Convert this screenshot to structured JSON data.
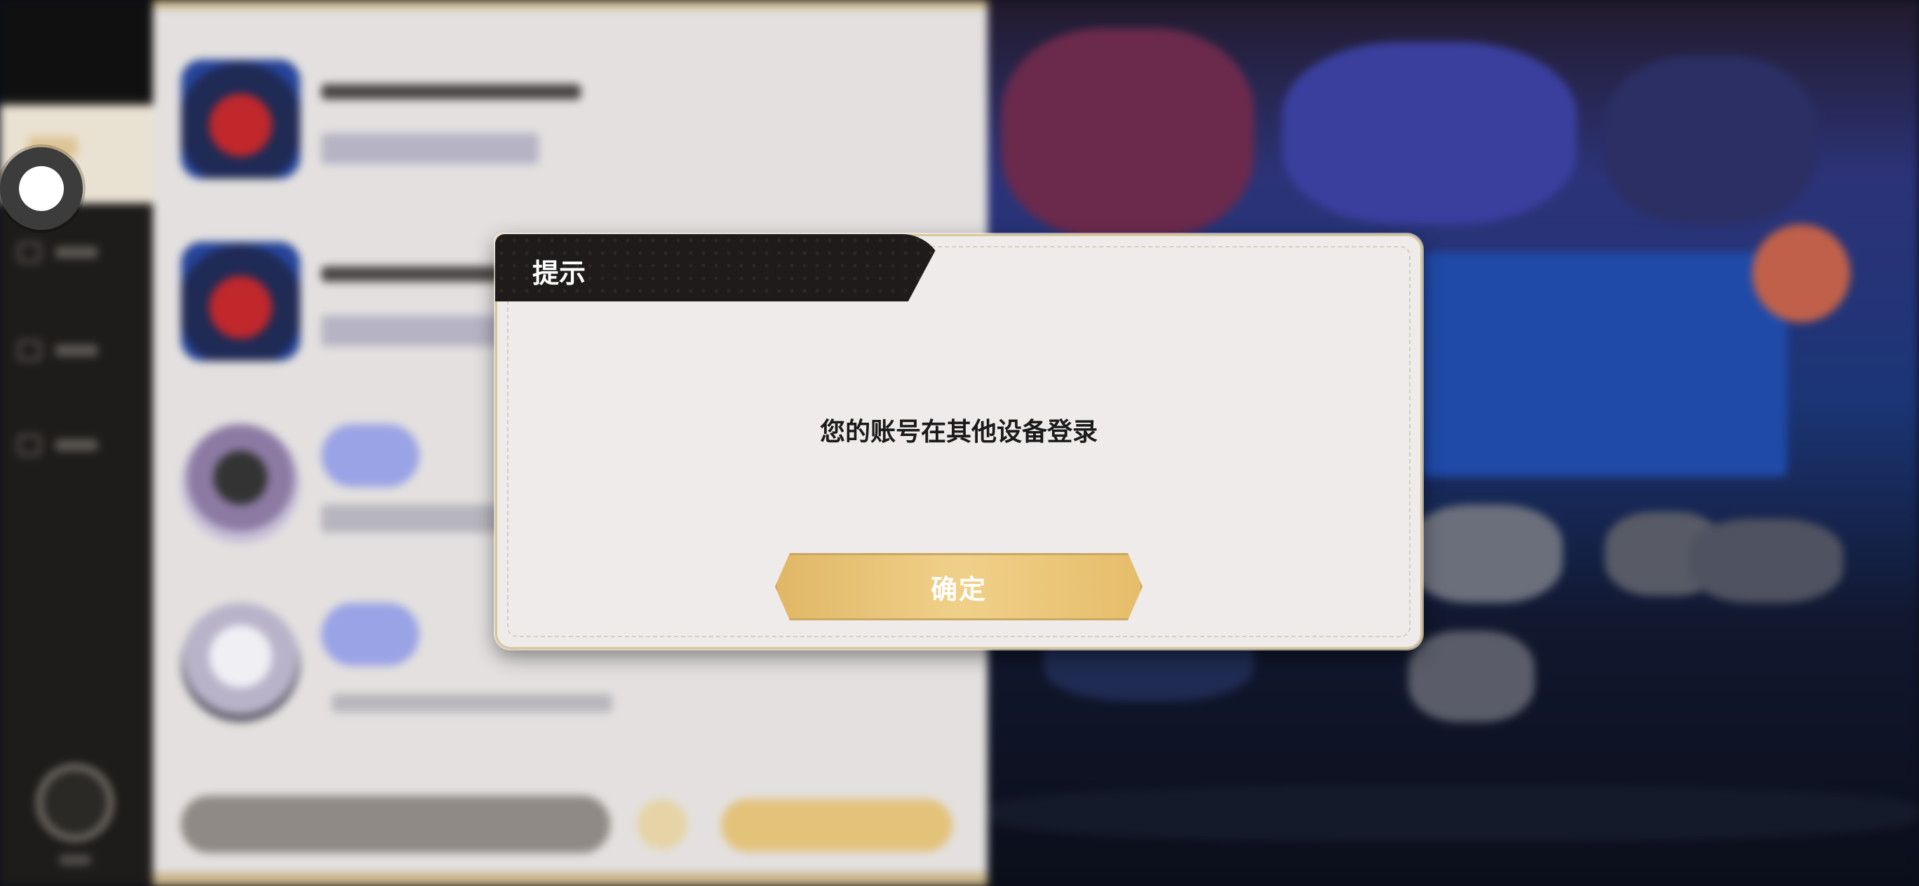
{
  "dialog": {
    "title": "提示",
    "message": "您的账号在其他设备登录",
    "confirm_label": "确定"
  },
  "colors": {
    "dialog_background": "#eeebea",
    "header_background": "#1e1b1a",
    "button_gold": "#e8c275",
    "border_gold": "#d9c79c"
  }
}
